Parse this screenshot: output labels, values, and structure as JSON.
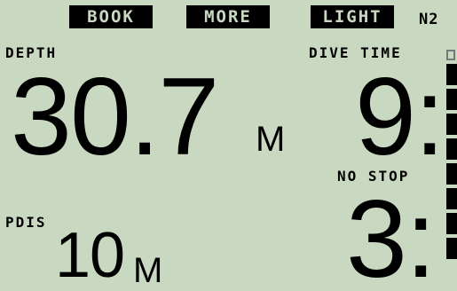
{
  "softkeys": {
    "book": "BOOK",
    "more": "MORE",
    "light": "LIGHT"
  },
  "gas_indicator": "N2",
  "depth": {
    "label": "DEPTH",
    "value": "30.7",
    "unit": "M"
  },
  "dive_time": {
    "label": "DIVE TIME",
    "value": "9:"
  },
  "no_stop": {
    "label": "NO STOP",
    "value": "3:"
  },
  "pdis": {
    "label": "PDIS",
    "value": "10",
    "unit": "M"
  },
  "colors": {
    "lcd_background": "#c9d9c1",
    "segment": "#000000"
  },
  "nitrogen_bar": {
    "filled_segments": 8,
    "total_segments": 9
  }
}
